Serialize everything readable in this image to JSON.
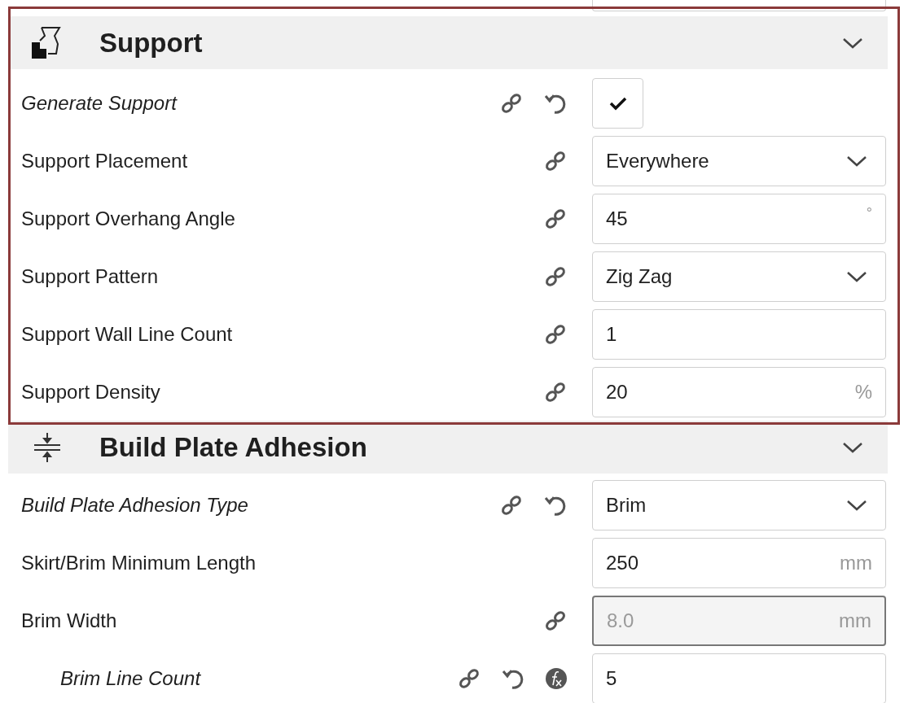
{
  "sections": [
    {
      "title": "Support",
      "settings": [
        {
          "label": "Generate Support",
          "modified": true,
          "linked": true,
          "kind": "checkbox",
          "checked": true
        },
        {
          "label": "Support Placement",
          "modified": false,
          "linked": true,
          "kind": "dropdown",
          "value": "Everywhere"
        },
        {
          "label": "Support Overhang Angle",
          "modified": false,
          "linked": true,
          "kind": "number",
          "value": "45",
          "unit": "°"
        },
        {
          "label": "Support Pattern",
          "modified": false,
          "linked": true,
          "kind": "dropdown",
          "value": "Zig Zag"
        },
        {
          "label": "Support Wall Line Count",
          "modified": false,
          "linked": true,
          "kind": "number",
          "value": "1"
        },
        {
          "label": "Support Density",
          "modified": false,
          "linked": true,
          "kind": "number",
          "value": "20",
          "unit": "%"
        }
      ]
    },
    {
      "title": "Build Plate Adhesion",
      "settings": [
        {
          "label": "Build Plate Adhesion Type",
          "modified": true,
          "linked": true,
          "kind": "dropdown",
          "value": "Brim"
        },
        {
          "label": "Skirt/Brim Minimum Length",
          "modified": false,
          "linked": false,
          "kind": "number",
          "value": "250",
          "unit": "mm"
        },
        {
          "label": "Brim Width",
          "modified": false,
          "linked": true,
          "kind": "number",
          "value": "8.0",
          "unit": "mm",
          "disabled": true,
          "children": [
            {
              "label": "Brim Line Count",
              "modified": true,
              "linked": true,
              "formula": true,
              "kind": "number",
              "value": "5"
            }
          ]
        }
      ]
    }
  ]
}
